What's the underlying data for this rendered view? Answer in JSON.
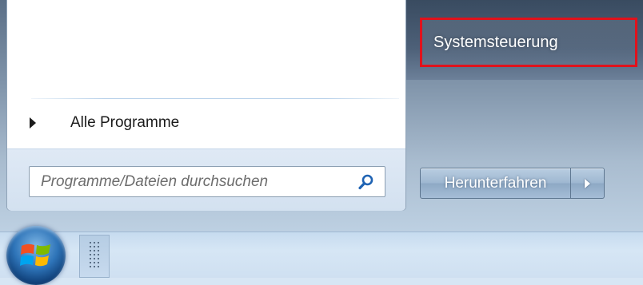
{
  "start_menu": {
    "all_programs": {
      "label": "Alle Programme",
      "icon": "triangle-right-icon"
    },
    "search": {
      "placeholder": "Programme/Dateien durchsuchen",
      "value": "",
      "icon": "magnifier-icon"
    },
    "right_pane": {
      "items": [
        {
          "label": "Systemsteuerung",
          "highlighted": true
        }
      ],
      "shutdown": {
        "label": "Herunterfahren",
        "options_icon": "triangle-right-icon"
      }
    }
  },
  "taskbar": {
    "start_button_icon": "windows-orb-icon",
    "grip_icon": "dotted-grip-icon"
  },
  "colors": {
    "highlight_border": "#e0121c",
    "accent_blue": "#2e74b8"
  }
}
